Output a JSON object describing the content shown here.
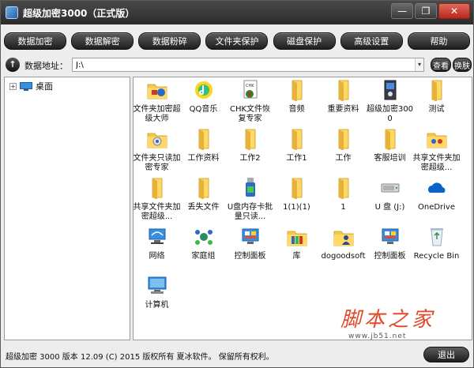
{
  "window": {
    "title": "超级加密3000（正式版）",
    "minimize": "—",
    "restore": "❐",
    "close": "✕"
  },
  "toolbar": {
    "buttons": [
      "数据加密",
      "数据解密",
      "数据粉碎",
      "文件夹保护",
      "磁盘保护",
      "高级设置",
      "帮助"
    ]
  },
  "address": {
    "label": "数据地址：",
    "value": "J:\\",
    "view_button": "查看",
    "switch_button": "换肤"
  },
  "tree": {
    "expander": "+",
    "root_label": "桌面"
  },
  "files": [
    {
      "label": "文件夹加密超级大师",
      "icon": "app-folder-lock-icon"
    },
    {
      "label": "QQ音乐",
      "icon": "qq-music-icon"
    },
    {
      "label": "CHK文件恢复专家",
      "icon": "chk-recovery-icon"
    },
    {
      "label": "音频",
      "icon": "folder-icon"
    },
    {
      "label": "重要资料",
      "icon": "folder-icon"
    },
    {
      "label": "超级加密3000",
      "icon": "super-encrypt-icon"
    },
    {
      "label": "测试",
      "icon": "folder-icon"
    },
    {
      "label": "文件夹只读加密专家",
      "icon": "folder-readonly-icon"
    },
    {
      "label": "工作资料",
      "icon": "folder-icon"
    },
    {
      "label": "工作2",
      "icon": "folder-icon"
    },
    {
      "label": "工作1",
      "icon": "folder-icon"
    },
    {
      "label": "工作",
      "icon": "folder-icon"
    },
    {
      "label": "客服培训",
      "icon": "folder-icon"
    },
    {
      "label": "共享文件夹加密超级...",
      "icon": "shared-folder-icon"
    },
    {
      "label": "共享文件夹加密超级...",
      "icon": "folder-icon"
    },
    {
      "label": "丢失文件",
      "icon": "folder-icon"
    },
    {
      "label": "U盘内存卡批量只读...",
      "icon": "usb-tool-icon"
    },
    {
      "label": "1(1)(1)",
      "icon": "folder-icon"
    },
    {
      "label": "1",
      "icon": "folder-icon"
    },
    {
      "label": "U 盘 (J:)",
      "icon": "usb-drive-icon"
    },
    {
      "label": "OneDrive",
      "icon": "onedrive-icon"
    },
    {
      "label": "网络",
      "icon": "network-icon"
    },
    {
      "label": "家庭组",
      "icon": "homegroup-icon"
    },
    {
      "label": "控制面板",
      "icon": "control-panel-icon"
    },
    {
      "label": "库",
      "icon": "library-icon"
    },
    {
      "label": "dogoodsoft",
      "icon": "user-folder-icon"
    },
    {
      "label": "控制面板",
      "icon": "control-panel-icon"
    },
    {
      "label": "Recycle Bin",
      "icon": "recycle-bin-icon"
    },
    {
      "label": "计算机",
      "icon": "computer-icon"
    }
  ],
  "status": {
    "text": "超级加密 3000 版本 12.09 (C) 2015 版权所有 夏冰软件。 保留所有权利。",
    "exit_button": "退出"
  },
  "watermark": {
    "main": "脚本之家",
    "url": "www.jb51.net"
  },
  "colors": {
    "folder": "#f5c84a",
    "accent_dark": "#1e1e1e",
    "watermark": "#e04a2a"
  }
}
